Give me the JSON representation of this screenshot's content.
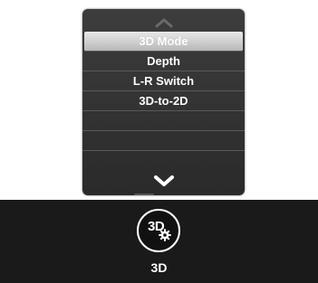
{
  "menu": {
    "up_icon": "chevron-up-icon",
    "down_icon": "chevron-down-icon",
    "items": [
      {
        "label": "3D Mode",
        "selected": true
      },
      {
        "label": "Depth",
        "selected": false
      },
      {
        "label": "L-R Switch",
        "selected": false
      },
      {
        "label": "3D-to-2D",
        "selected": false
      },
      {
        "label": "",
        "selected": false
      },
      {
        "label": "",
        "selected": false
      }
    ]
  },
  "bottom_bar": {
    "button_icon_text": "3D",
    "button_icon": "gear-icon",
    "label": "3D"
  },
  "colors": {
    "menu_background": "#333333",
    "selected_highlight": "#cfcfcf",
    "bar_background": "#1a1a1a",
    "text": "#ffffff"
  }
}
